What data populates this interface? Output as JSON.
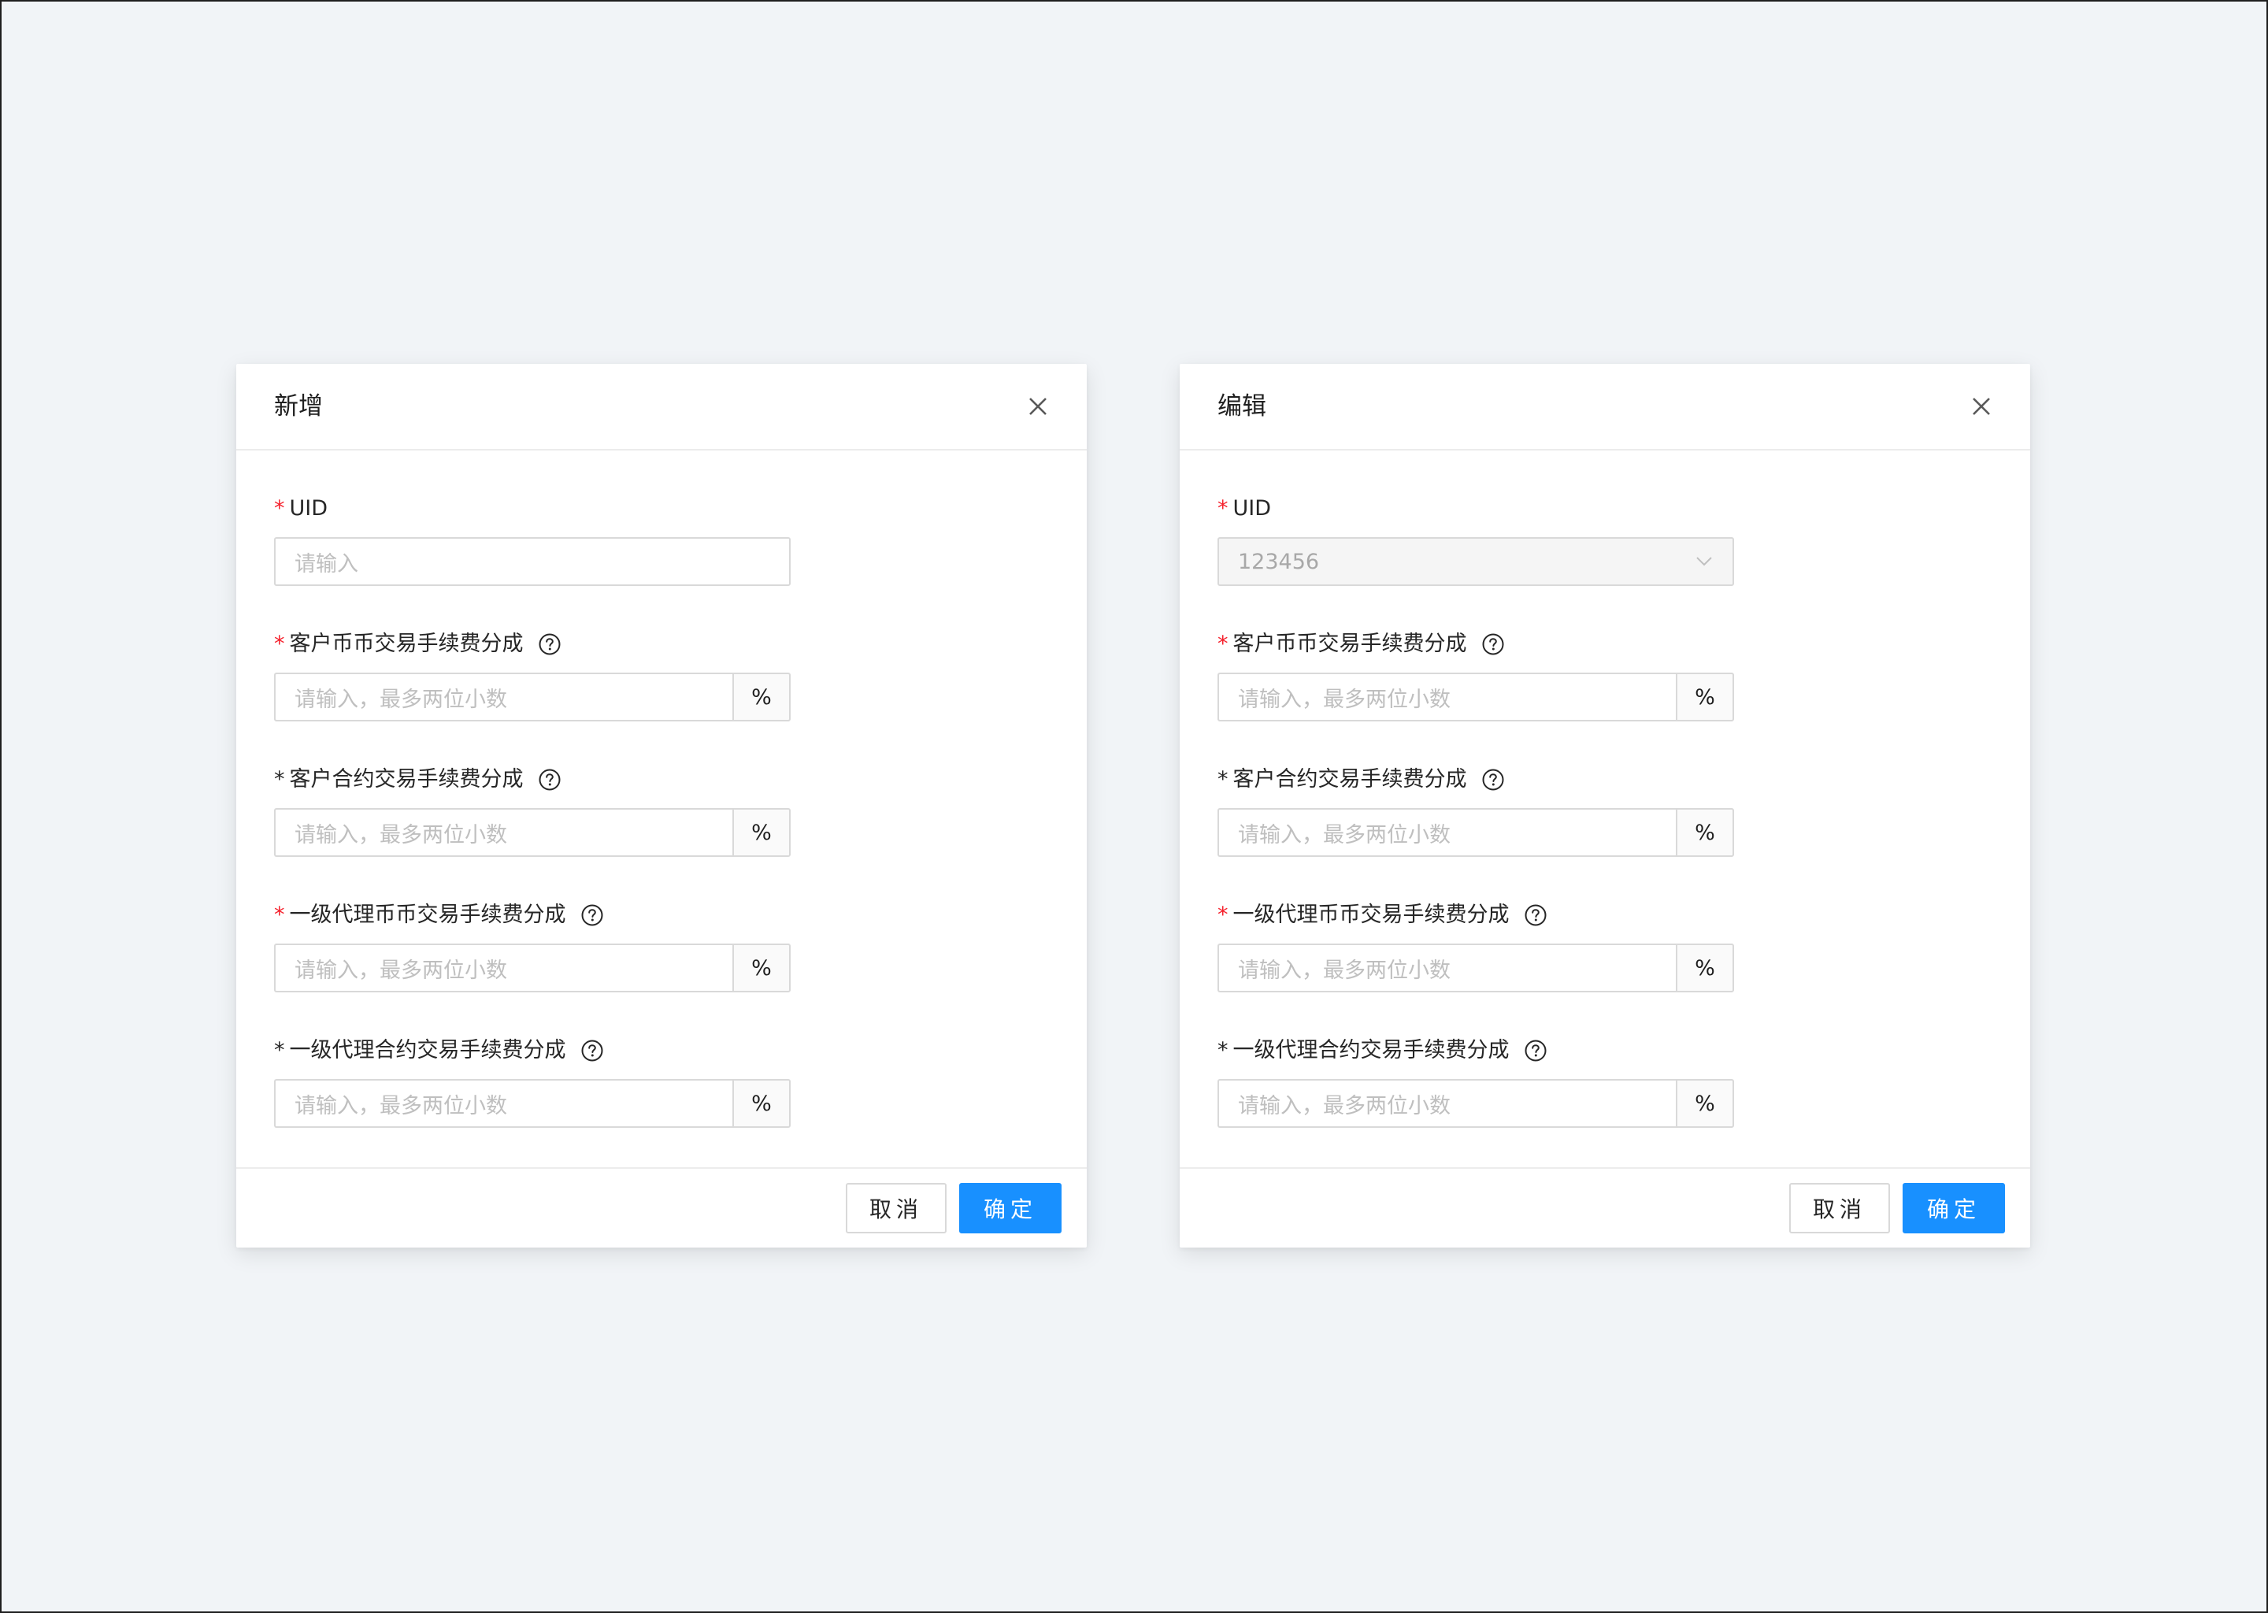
{
  "dialogs": [
    {
      "title": "新增",
      "uid": {
        "label": "UID",
        "placeholder": "请输入",
        "required": "*"
      },
      "fields": [
        {
          "marker": "*",
          "label": "客户币币交易手续费分成",
          "placeholder": "请输入，最多两位小数",
          "suffix": "%"
        },
        {
          "marker": "*",
          "label": "客户合约交易手续费分成",
          "placeholder": "请输入，最多两位小数",
          "suffix": "%"
        },
        {
          "marker": "*",
          "label": "一级代理币币交易手续费分成",
          "placeholder": "请输入，最多两位小数",
          "suffix": "%"
        },
        {
          "marker": "*",
          "label": "一级代理合约交易手续费分成",
          "placeholder": "请输入，最多两位小数",
          "suffix": "%"
        }
      ],
      "cancel_label": "取消",
      "ok_label": "确定"
    },
    {
      "title": "编辑",
      "uid": {
        "label": "UID",
        "value": "123456",
        "required": "*"
      },
      "fields": [
        {
          "marker": "*",
          "label": "客户币币交易手续费分成",
          "placeholder": "请输入，最多两位小数",
          "suffix": "%"
        },
        {
          "marker": "*",
          "label": "客户合约交易手续费分成",
          "placeholder": "请输入，最多两位小数",
          "suffix": "%"
        },
        {
          "marker": "*",
          "label": "一级代理币币交易手续费分成",
          "placeholder": "请输入，最多两位小数",
          "suffix": "%"
        },
        {
          "marker": "*",
          "label": "一级代理合约交易手续费分成",
          "placeholder": "请输入，最多两位小数",
          "suffix": "%"
        }
      ],
      "cancel_label": "取消",
      "ok_label": "确定"
    }
  ],
  "icons": {
    "close": "close-icon",
    "help": "question-circle-icon",
    "dropdown": "chevron-down-icon"
  },
  "colors": {
    "primary": "#1890ff",
    "required": "#f5222d",
    "background": "#f1f4f7"
  }
}
